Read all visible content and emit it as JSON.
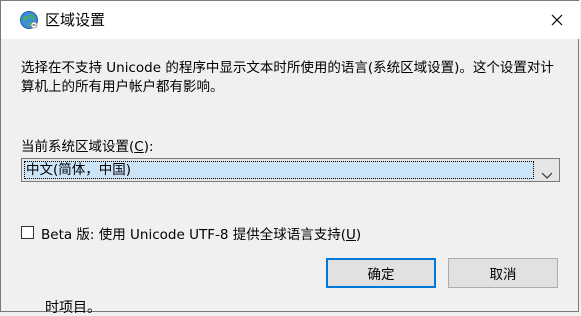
{
  "window": {
    "title": "区域设置",
    "close_symbol": "✕"
  },
  "description": "选择在不支持 Unicode 的程序中显示文本时所使用的语言(系统区域设置)。这个设置对计算机上的所有用户帐户都有影响。",
  "locale": {
    "label_prefix": "当前系统区域设置(",
    "label_accel": "C",
    "label_suffix": "):",
    "selected": "中文(简体，中国)"
  },
  "beta": {
    "label_prefix": "Beta 版: 使用 Unicode UTF-8 提供全球语言支持(",
    "label_accel": "U",
    "label_suffix": ")",
    "checked": false
  },
  "buttons": {
    "ok": "确定",
    "cancel": "取消"
  },
  "background_text": "时项目。",
  "icons": {
    "title": "globe-icon",
    "close": "close-icon",
    "dropdown": "chevron-down-icon"
  }
}
